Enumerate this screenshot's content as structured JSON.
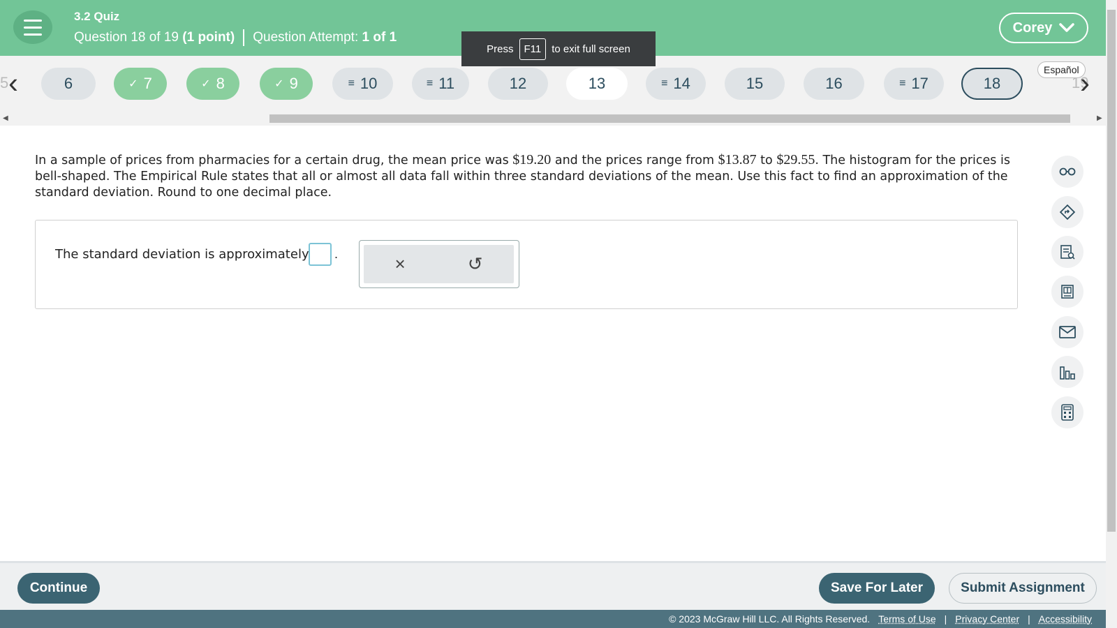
{
  "header": {
    "quiz_title": "3.2 Quiz",
    "question_label": "Question 18 of 19",
    "points": "(1 point)",
    "attempt_label": "Question Attempt:",
    "attempt_value": "1 of 1",
    "user_name": "Corey"
  },
  "fullscreen_toast": {
    "press": "Press",
    "key": "F11",
    "message": "to exit full screen"
  },
  "question_nav": {
    "prev_partial": "5",
    "next_partial": "19",
    "language_label": "Español",
    "items": [
      {
        "number": "6",
        "status": "unanswered"
      },
      {
        "number": "7",
        "status": "correct",
        "mark": "✓"
      },
      {
        "number": "8",
        "status": "correct",
        "mark": "✓"
      },
      {
        "number": "9",
        "status": "correct",
        "mark": "✓"
      },
      {
        "number": "10",
        "status": "partial",
        "mark": "≡"
      },
      {
        "number": "11",
        "status": "partial",
        "mark": "≡"
      },
      {
        "number": "12",
        "status": "unanswered"
      },
      {
        "number": "13",
        "status": "unanswered"
      },
      {
        "number": "14",
        "status": "partial",
        "mark": "≡"
      },
      {
        "number": "15",
        "status": "unanswered"
      },
      {
        "number": "16",
        "status": "unanswered"
      },
      {
        "number": "17",
        "status": "partial",
        "mark": "≡"
      },
      {
        "number": "18",
        "status": "current"
      }
    ]
  },
  "question": {
    "part1": "In a sample of prices from pharmacies for a certain drug, the mean price was ",
    "mean": "$19.20",
    "part2": " and the prices range from ",
    "min": "$13.87",
    "part3": " to ",
    "max": "$29.55",
    "part4": ". The histogram for the prices is bell-shaped. The Empirical Rule states that all or almost all data fall within three standard deviations of the mean. Use this fact to find an approximation of the standard deviation. Round to one decimal place."
  },
  "answer": {
    "prompt": "The standard deviation is approximately",
    "value": "",
    "suffix": ".",
    "clear_icon": "×",
    "undo_icon": "↺"
  },
  "side_tools": [
    "glasses-icon",
    "hint-icon",
    "checklist-icon",
    "ebook-icon",
    "mail-icon",
    "bar-chart-icon",
    "calculator-icon"
  ],
  "footer": {
    "continue_label": "Continue",
    "save_label": "Save For Later",
    "submit_label": "Submit Assignment",
    "copyright": "© 2023 McGraw Hill LLC. All Rights Reserved.",
    "terms": "Terms of Use",
    "privacy": "Privacy Center",
    "accessibility": "Accessibility",
    "divider": "|"
  },
  "colors": {
    "header_green": "#72c597",
    "done_green": "#8acf9e",
    "teal_dark": "#3b6472",
    "footer_bar": "#4f7380"
  }
}
